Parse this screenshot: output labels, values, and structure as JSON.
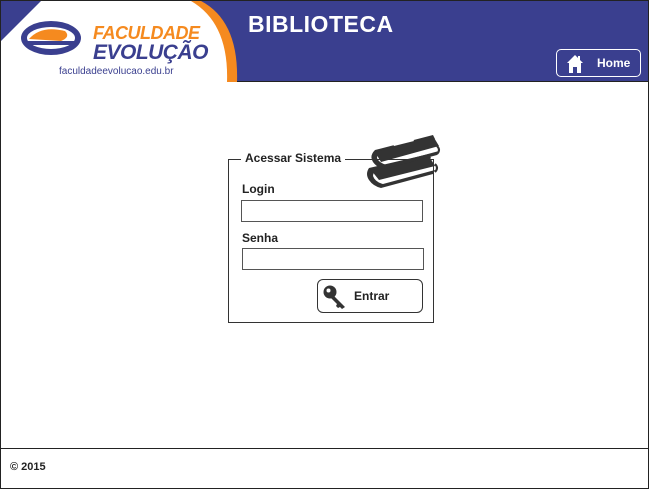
{
  "logo": {
    "line1": "FACULDADE",
    "line2": "EVOLUÇÃO",
    "url": "faculdadeevolucao.edu.br"
  },
  "header": {
    "title": "BIBLIOTECA",
    "home_label": "Home"
  },
  "login": {
    "legend": "Acessar Sistema",
    "login_label": "Login",
    "login_value": "",
    "password_label": "Senha",
    "password_value": "",
    "submit_label": "Entrar"
  },
  "footer": {
    "text": "© 2015"
  },
  "icons": {
    "home": "home-icon",
    "books": "books-icon",
    "key": "key-icon"
  },
  "colors": {
    "header_bg": "#3a3f8f",
    "brand_orange": "#f58a1f"
  }
}
